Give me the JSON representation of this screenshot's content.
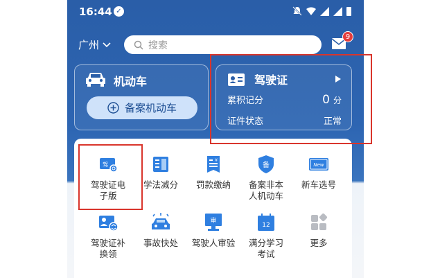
{
  "status_bar": {
    "time": "16:44",
    "app_icon": "compass-icon"
  },
  "header": {
    "city": "广州",
    "search_placeholder": "搜索",
    "mail_badge": "9"
  },
  "vehicle_card": {
    "title": "机动车",
    "button_label": "备案机动车"
  },
  "license_card": {
    "title": "驾驶证",
    "points_label": "累积记分",
    "points_value": "0",
    "points_unit": "分",
    "status_label": "证件状态",
    "status_value": "正常"
  },
  "services": [
    {
      "line1": "驾驶证电",
      "line2": "子版",
      "icon": "license-e-icon"
    },
    {
      "line1": "学法减分",
      "line2": "",
      "icon": "book-icon"
    },
    {
      "line1": "罚款缴纳",
      "line2": "",
      "icon": "fine-icon"
    },
    {
      "line1": "备案非本",
      "line2": "人机动车",
      "icon": "shield-bei-icon"
    },
    {
      "line1": "新车选号",
      "line2": "",
      "icon": "new-plate-icon"
    },
    {
      "line1": "驾驶证补",
      "line2": "换领",
      "icon": "license-renew-icon"
    },
    {
      "line1": "事故快处",
      "line2": "",
      "icon": "accident-icon"
    },
    {
      "line1": "驾驶人审验",
      "line2": "",
      "icon": "review-icon"
    },
    {
      "line1": "满分学习",
      "line2": "考试",
      "icon": "calendar-12-icon"
    },
    {
      "line1": "更多",
      "line2": "",
      "icon": "more-grid-icon"
    }
  ],
  "icon_texts": {
    "plate_new": "New",
    "calendar_day": "12",
    "shield_char": "备",
    "review_char": "审",
    "license_char": "驾"
  },
  "colors": {
    "primary": "#2a5ea8",
    "annotation": "#d9352c",
    "badge": "#e43d3d"
  }
}
